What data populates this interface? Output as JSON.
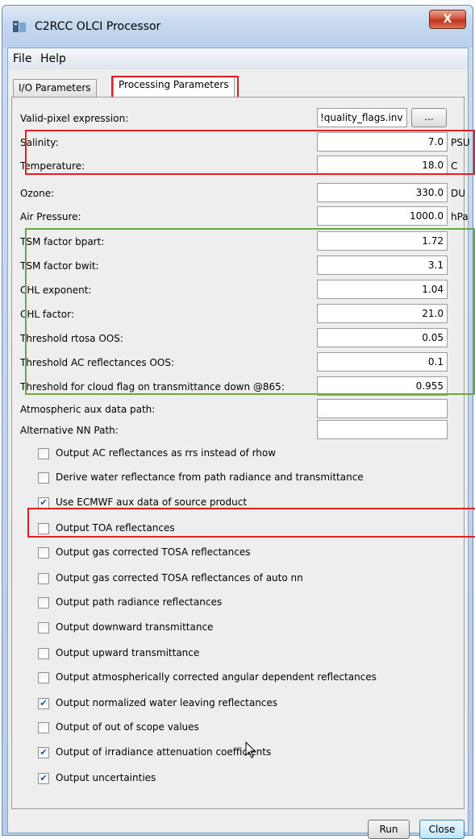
{
  "window": {
    "title": "C2RCC OLCI Processor",
    "close_label": "X"
  },
  "menu": [
    "File",
    "Help"
  ],
  "tabs": [
    "I/O Parameters",
    "Processing Parameters"
  ],
  "valid_pixel": {
    "label": "Valid-pixel expression:",
    "value": "!quality_flags.inv",
    "button": "..."
  },
  "params": [
    {
      "label": "Salinity:",
      "value": "7.0",
      "unit": "PSU"
    },
    {
      "label": "Temperature:",
      "value": "18.0",
      "unit": "C"
    },
    {
      "label": "Ozone:",
      "value": "330.0",
      "unit": "DU"
    },
    {
      "label": "Air Pressure:",
      "value": "1000.0",
      "unit": "hPa"
    },
    {
      "label": "TSM factor bpart:",
      "value": "1.72",
      "unit": ""
    },
    {
      "label": "TSM factor bwit:",
      "value": "3.1",
      "unit": ""
    },
    {
      "label": "CHL exponent:",
      "value": "1.04",
      "unit": ""
    },
    {
      "label": "CHL factor:",
      "value": "21.0",
      "unit": ""
    },
    {
      "label": "Threshold rtosa OOS:",
      "value": "0.05",
      "unit": ""
    },
    {
      "label": "Threshold AC reflectances OOS:",
      "value": "0.1",
      "unit": ""
    },
    {
      "label": "Threshold for cloud flag on transmittance down @865:",
      "value": "0.955",
      "unit": ""
    }
  ],
  "paths": [
    {
      "label": "Atmospheric aux data path:",
      "value": ""
    },
    {
      "label": "Alternative NN Path:",
      "value": ""
    }
  ],
  "checkboxes": [
    {
      "label": "Output AC reflectances as rrs instead of rhow",
      "checked": false
    },
    {
      "label": "Derive water reflectance from path radiance and transmittance",
      "checked": false
    },
    {
      "label": "Use ECMWF aux data of source product",
      "checked": true
    },
    {
      "label": "Output TOA reflectances",
      "checked": false
    },
    {
      "label": "Output gas corrected TOSA reflectances",
      "checked": false
    },
    {
      "label": "Output gas corrected TOSA reflectances of auto nn",
      "checked": false
    },
    {
      "label": "Output path radiance reflectances",
      "checked": false
    },
    {
      "label": "Output downward transmittance",
      "checked": false
    },
    {
      "label": "Output upward transmittance",
      "checked": false
    },
    {
      "label": "Output atmospherically corrected angular dependent reflectances",
      "checked": false
    },
    {
      "label": "Output normalized water leaving reflectances",
      "checked": true
    },
    {
      "label": "Output of out of scope values",
      "checked": false
    },
    {
      "label": "Output of irradiance attenuation coefficients",
      "checked": true
    },
    {
      "label": "Output uncertainties",
      "checked": true
    }
  ],
  "buttons": {
    "run": "Run",
    "close": "Close"
  },
  "colors": {
    "highlight_red": "#e02020",
    "highlight_green": "#6aa842",
    "check": "#1c4f9c"
  }
}
